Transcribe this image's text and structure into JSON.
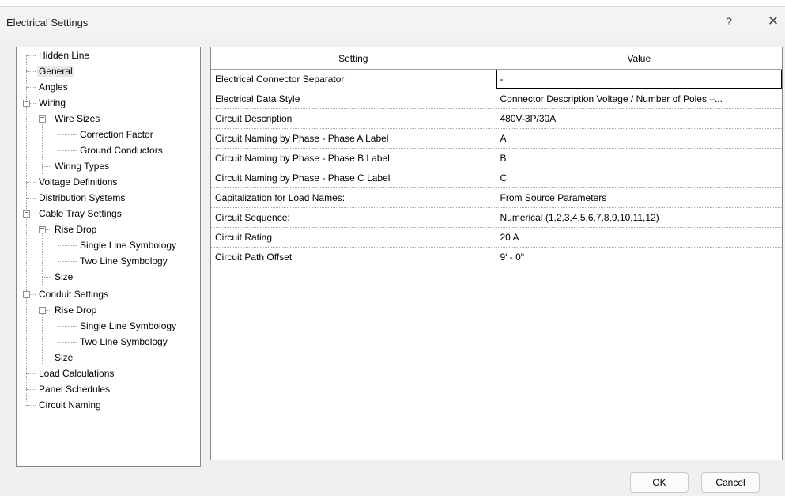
{
  "window": {
    "title": "Electrical Settings",
    "help_glyph": "?",
    "close_glyph": "✕"
  },
  "tree": [
    {
      "label": "Hidden Line"
    },
    {
      "label": "General",
      "selected": true
    },
    {
      "label": "Angles"
    },
    {
      "label": "Wiring",
      "expanded": true
    },
    {
      "label": "Wire Sizes",
      "expanded": true
    },
    {
      "label": "Correction Factor"
    },
    {
      "label": "Ground Conductors"
    },
    {
      "label": "Wiring Types"
    },
    {
      "label": "Voltage Definitions"
    },
    {
      "label": "Distribution Systems"
    },
    {
      "label": "Cable Tray Settings",
      "expanded": true
    },
    {
      "label": "Rise Drop",
      "expanded": true
    },
    {
      "label": "Single Line Symbology"
    },
    {
      "label": "Two Line Symbology"
    },
    {
      "label": "Size"
    },
    {
      "label": "Conduit Settings",
      "expanded": true
    },
    {
      "label": "Rise Drop",
      "expanded": true
    },
    {
      "label": "Single Line Symbology"
    },
    {
      "label": "Two Line Symbology"
    },
    {
      "label": "Size"
    },
    {
      "label": "Load Calculations"
    },
    {
      "label": "Panel Schedules"
    },
    {
      "label": "Circuit Naming"
    }
  ],
  "table": {
    "headers": {
      "setting": "Setting",
      "value": "Value"
    },
    "rows": [
      {
        "setting": "Electrical Connector Separator",
        "value": "-"
      },
      {
        "setting": "Electrical Data Style",
        "value": "Connector Description Voltage / Number of Poles –..."
      },
      {
        "setting": "Circuit Description",
        "value": "480V-3P/30A"
      },
      {
        "setting": "Circuit Naming by Phase - Phase A Label",
        "value": "A"
      },
      {
        "setting": "Circuit Naming by Phase - Phase B Label",
        "value": "B"
      },
      {
        "setting": "Circuit Naming by Phase - Phase C Label",
        "value": "C"
      },
      {
        "setting": "Capitalization for Load Names:",
        "value": "From Source Parameters"
      },
      {
        "setting": "Circuit Sequence:",
        "value": "Numerical (1,2,3,4,5,6,7,8,9,10,11,12)"
      },
      {
        "setting": "Circuit Rating",
        "value": "20 A"
      },
      {
        "setting": "Circuit Path Offset",
        "value": "9' - 0\""
      }
    ]
  },
  "buttons": {
    "ok": "OK",
    "cancel": "Cancel"
  }
}
